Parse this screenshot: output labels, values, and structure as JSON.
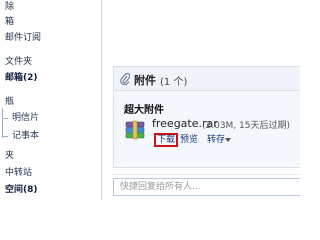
{
  "sidebar": {
    "items": [
      {
        "label": "除",
        "bold": false,
        "child": false
      },
      {
        "label": "箱",
        "bold": false,
        "child": false
      },
      {
        "label": "邮件订阅",
        "bold": false,
        "child": false
      },
      {
        "label": "文件夹",
        "bold": false,
        "child": false
      },
      {
        "label": "邮箱(2)",
        "bold": true,
        "child": false
      },
      {
        "label": "瓶",
        "bold": false,
        "child": false
      },
      {
        "label": "明信片",
        "bold": false,
        "child": true
      },
      {
        "label": "记事本",
        "bold": false,
        "child": true
      },
      {
        "label": "夹",
        "bold": false,
        "child": false
      },
      {
        "label": "中转站",
        "bold": false,
        "child": false
      },
      {
        "label": "空间(8)",
        "bold": true,
        "child": false
      }
    ]
  },
  "attachment": {
    "title": "附件",
    "count": "(1 个)",
    "section_label": "超大附件",
    "file_name": "freegate.rar",
    "file_meta": "(2.03M, 15天后过期)",
    "actions": {
      "download": "下载",
      "preview": "预览",
      "save": "转存"
    }
  },
  "reply": {
    "placeholder": "快捷回复给所有人..."
  },
  "colors": {
    "highlight_border": "#cc1414",
    "link": "#1a3d7a",
    "sidebar_border": "#c9d9ec"
  }
}
